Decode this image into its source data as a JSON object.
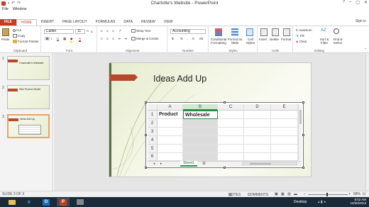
{
  "window": {
    "title": "Charlotte's Website - PowerPoint",
    "minimize": "–",
    "restore": "▢",
    "close": "✕",
    "help": "?"
  },
  "menubar": {
    "items": [
      "File",
      "Window"
    ]
  },
  "ribbon_tabs": [
    "FILE",
    "HOME",
    "INSERT",
    "PAGE LAYOUT",
    "FORMULAS",
    "DATA",
    "REVIEW",
    "VIEW"
  ],
  "sign_in": "Sign in",
  "ribbon": {
    "clipboard": {
      "paste": "Paste",
      "cut": "Cut",
      "copy": "Copy",
      "painter": "Format Painter",
      "label": "Clipboard"
    },
    "font": {
      "name": "Calibri",
      "size": "11",
      "label": "Font",
      "bold": "B",
      "italic": "I",
      "underline": "U"
    },
    "alignment": {
      "wrap": "Wrap Text",
      "merge": "Merge & Center",
      "label": "Alignment"
    },
    "number": {
      "format": "Accounting",
      "currency": "$",
      "percent": "%",
      "label": "Number"
    },
    "styles": {
      "conditional": "Conditional Formatting",
      "table": "Format as Table",
      "cell": "Cell Styles",
      "label": "Styles"
    },
    "cells": {
      "insert": "Insert",
      "delete": "Delete",
      "format": "Format",
      "label": "Cells"
    },
    "editing": {
      "autosum": "AutoSum",
      "fill": "Fill",
      "clear": "Clear",
      "sort": "Sort & Filter",
      "find": "Find & Select",
      "label": "Editing"
    }
  },
  "thumbnails": [
    {
      "num": "1",
      "text": "Charlotte's Website"
    },
    {
      "num": "2",
      "text": "Wiki Product Model"
    },
    {
      "num": "3",
      "text": "Ideas Add Up"
    }
  ],
  "slide": {
    "title": "Ideas Add Up"
  },
  "spreadsheet": {
    "columns": [
      "A",
      "B",
      "C",
      "D",
      "E"
    ],
    "rows": [
      "1",
      "2",
      "3",
      "4",
      "5",
      "6"
    ],
    "a1": "Product",
    "b1": "Wholesale",
    "sheet_tab": "Sheet1"
  },
  "statusbar": {
    "slide_info": "SLIDE 3 OF 3",
    "notes": "NOTES",
    "comments": "COMMENTS",
    "zoom": "68%"
  },
  "taskbar": {
    "desktop": "Desktop",
    "time": "6:52 AM",
    "date": "10/30/2013"
  }
}
